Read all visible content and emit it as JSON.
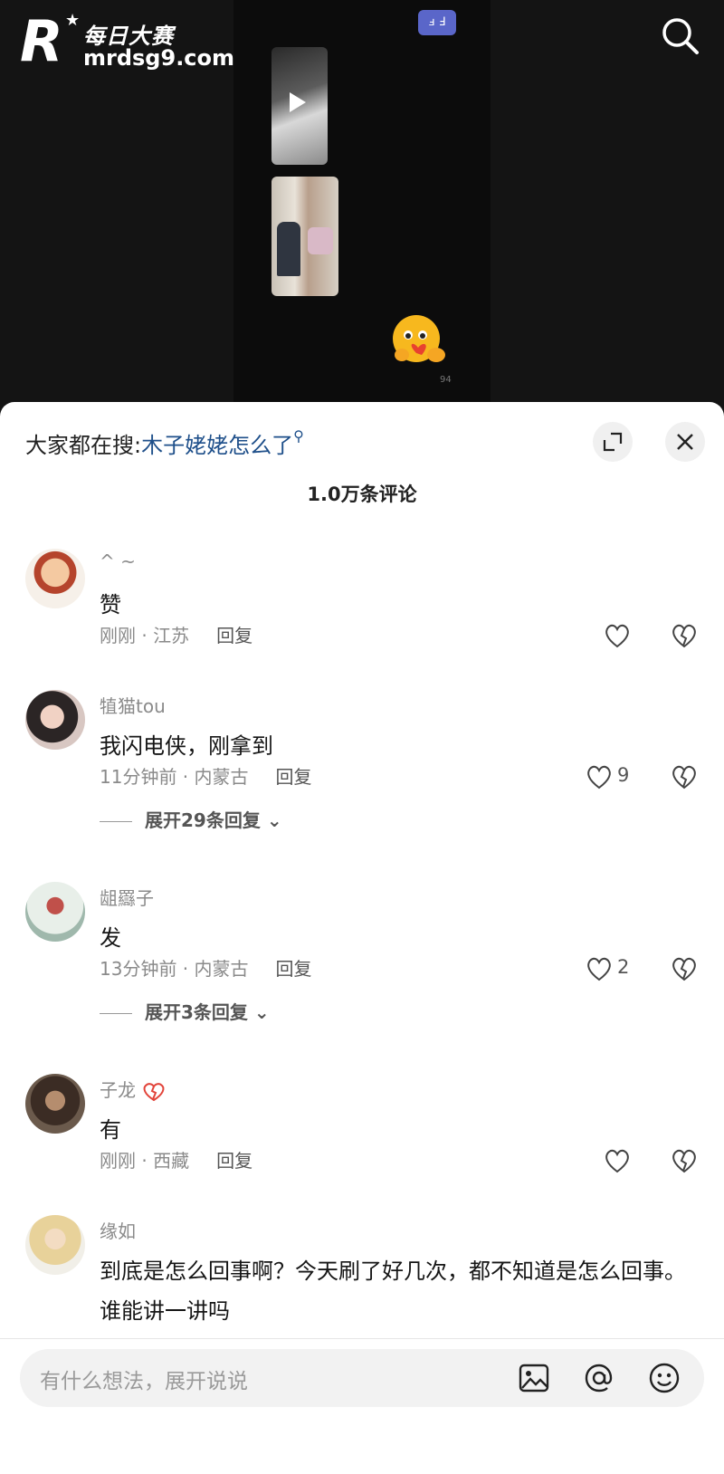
{
  "brand": {
    "letter": "R",
    "name_cn": "每日大赛",
    "url": "mrdsg9.com"
  },
  "video": {
    "badge": "ⅎ Ⅎ",
    "small_count": "94"
  },
  "search_icon": "search-icon",
  "comments_panel": {
    "hot_search_prefix": "大家都在搜:",
    "hot_search_keyword": "木子姥姥怎么了",
    "count_title": "1.0万条评论",
    "comments": [
      {
        "name": "^ ~",
        "text": "赞",
        "time": "刚刚 · 江苏",
        "reply": "回复",
        "likes": ""
      },
      {
        "name": "犆猫tou",
        "text": "我闪电侠，刚拿到",
        "time": "11分钟前 · 内蒙古",
        "reply": "回复",
        "likes": "9",
        "expand": "展开29条回复"
      },
      {
        "name": "龃羉子",
        "text": "发",
        "time": "13分钟前 · 内蒙古",
        "reply": "回复",
        "likes": "2",
        "expand": "展开3条回复"
      },
      {
        "name": "子龙",
        "text": "有",
        "time": "刚刚 · 西藏",
        "reply": "回复",
        "likes": ""
      },
      {
        "name": "缘如",
        "text": "到底是怎么回事啊？今天刷了好几次，都不知道是怎么回事。谁能讲一讲吗"
      }
    ]
  },
  "input": {
    "placeholder": "有什么想法，展开说说"
  },
  "colors": {
    "keyword": "#1e4f8a",
    "badge": "#5a66c9",
    "video_bg": "#141414"
  }
}
